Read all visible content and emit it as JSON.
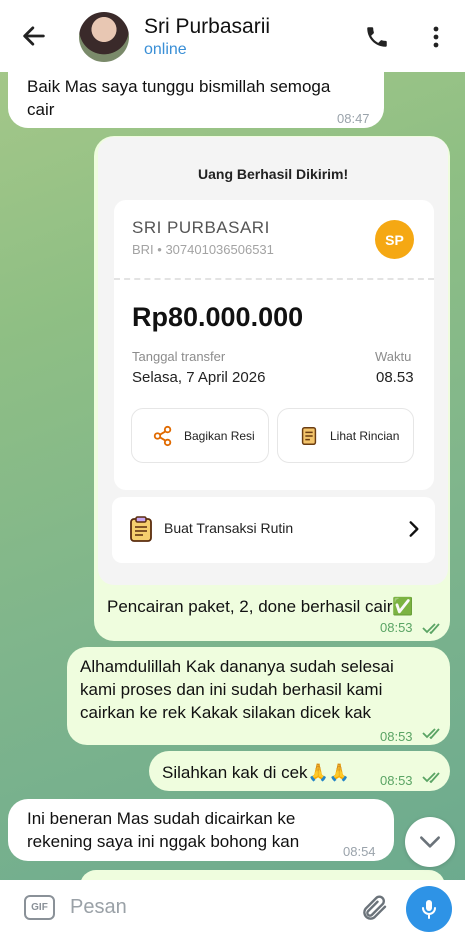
{
  "header": {
    "contact_name": "Sri Purbasarii",
    "status": "online",
    "icons": [
      "back-arrow-icon",
      "phone-icon",
      "more-vert-icon"
    ]
  },
  "messages": [
    {
      "dir": "in",
      "text_lines": [
        "Baik Mas saya tunggu bismillah semoga",
        "cair"
      ],
      "time": "08:47"
    },
    {
      "dir": "out",
      "type": "image",
      "caption": "Pencairan paket, 2, done berhasil cair",
      "caption_emoji": "✅",
      "time": "08:53",
      "ticks": "read"
    },
    {
      "dir": "out",
      "text_lines": [
        "Alhamdulillah Kak dananya sudah selesai",
        "kami proses dan ini sudah berhasil kami",
        "cairkan ke rek Kakak silakan dicek kak"
      ],
      "time": "08:53",
      "ticks": "read"
    },
    {
      "dir": "out",
      "text": "Silahkan kak di cek",
      "emoji": "🙏🙏",
      "time": "08:53",
      "ticks": "read"
    },
    {
      "dir": "in",
      "text_lines": [
        "Ini beneran Mas sudah dicairkan ke",
        "rekening saya ini nggak bohong kan"
      ],
      "time": "08:54"
    }
  ],
  "receipt": {
    "title": "Uang Berhasil Dikirim!",
    "recipient_name": "SRI PURBASARI",
    "account": "BRI • 307401036506531",
    "initials": "SP",
    "amount": "Rp80.000.000",
    "date_label": "Tanggal transfer",
    "date_value": "Selasa, 7 April 2026",
    "time_label": "Waktu",
    "time_value": "08.53",
    "share_button": "Bagikan Resi",
    "detail_button": "Lihat Rincian",
    "routine_label": "Buat Transaksi Rutin"
  },
  "input": {
    "gif_label": "GIF",
    "placeholder": "Pesan"
  },
  "colors": {
    "incoming_bubble": "#ffffff",
    "outgoing_bubble": "#effdde",
    "link_blue": "#3a8fd6",
    "mic_button": "#2e93e6",
    "avatar_initials_bg": "#f5a813"
  }
}
